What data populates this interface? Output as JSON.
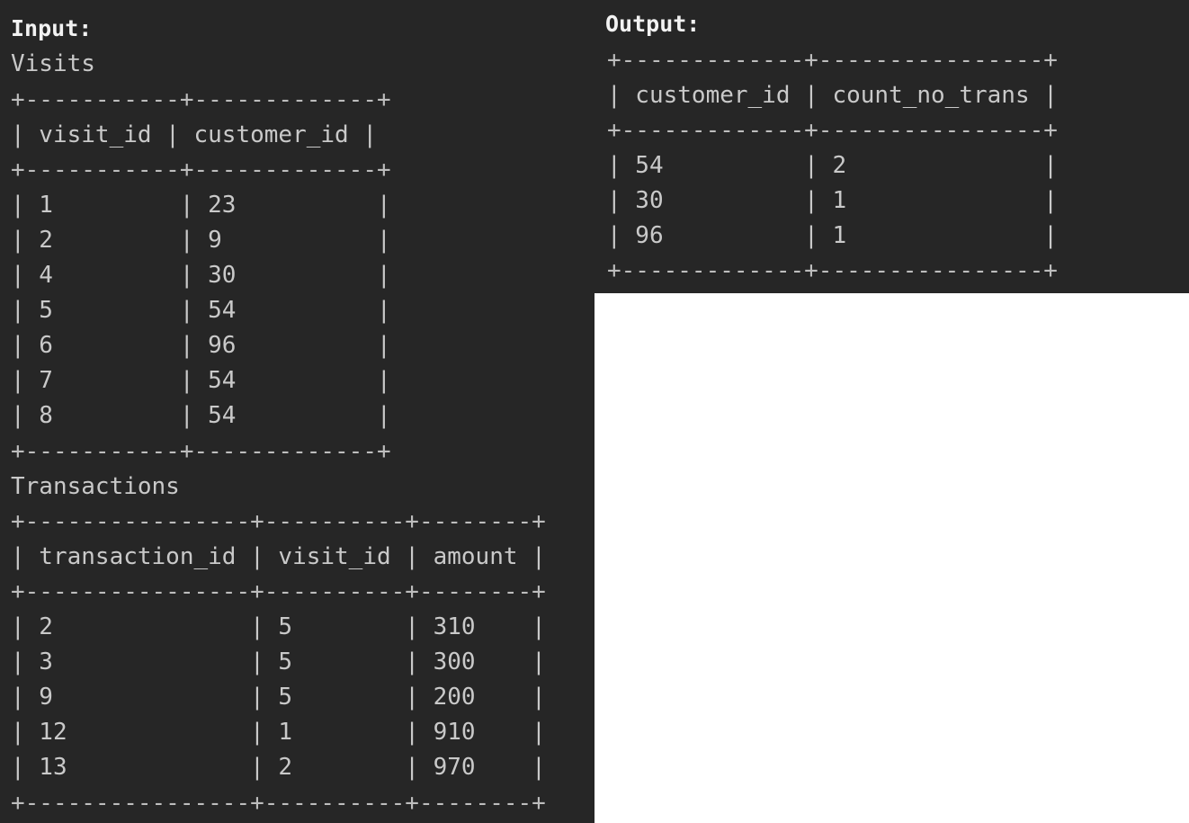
{
  "input_label": "Input:",
  "output_label": "Output:",
  "input": {
    "visits": {
      "title": "Visits",
      "lines": [
        "+-----------+-------------+",
        "| visit_id | customer_id |",
        "+-----------+-------------+",
        "| 1         | 23          |",
        "| 2         | 9           |",
        "| 4         | 30          |",
        "| 5         | 54          |",
        "| 6         | 96          |",
        "| 7         | 54          |",
        "| 8         | 54          |",
        "+-----------+-------------+"
      ]
    },
    "transactions": {
      "title": "Transactions",
      "lines": [
        "+----------------+----------+--------+",
        "| transaction_id | visit_id | amount |",
        "+----------------+----------+--------+",
        "| 2              | 5        | 310    |",
        "| 3              | 5        | 300    |",
        "| 9              | 5        | 200    |",
        "| 12             | 1        | 910    |",
        "| 13             | 2        | 970    |",
        "+----------------+----------+--------+"
      ]
    }
  },
  "output": {
    "lines": [
      "+-------------+----------------+",
      "| customer_id | count_no_trans |",
      "+-------------+----------------+",
      "| 54          | 2              |",
      "| 30          | 1              |",
      "| 96          | 1              |",
      "+-------------+----------------+"
    ]
  }
}
